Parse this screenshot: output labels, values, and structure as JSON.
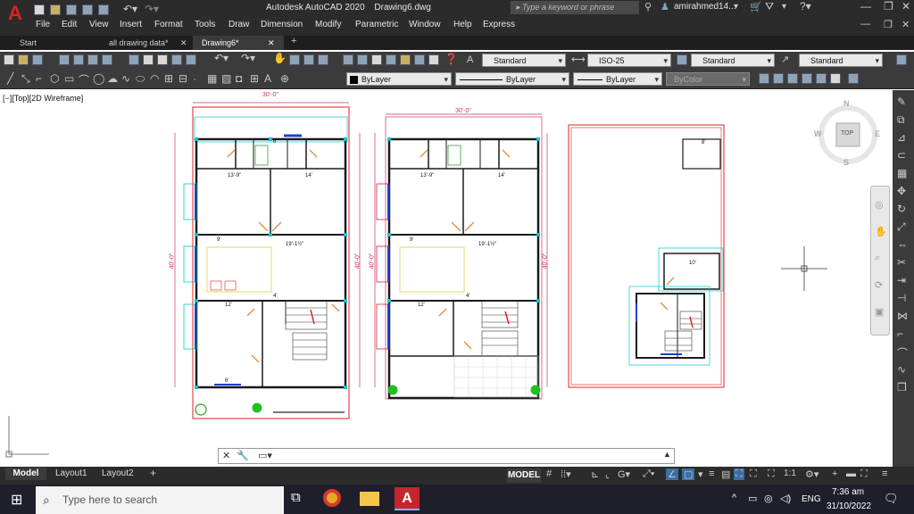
{
  "app": {
    "title": "Autodesk AutoCAD 2020",
    "filename": "Drawing6.dwg",
    "search_placeholder": "Type a keyword or phrase",
    "user": "amirahmed14...",
    "logo_letter": "A"
  },
  "menu": [
    "File",
    "Edit",
    "View",
    "Insert",
    "Format",
    "Tools",
    "Draw",
    "Dimension",
    "Modify",
    "Parametric",
    "Window",
    "Help",
    "Express"
  ],
  "tabs": [
    {
      "label": "Start"
    },
    {
      "label": "all drawing data*"
    },
    {
      "label": "Drawing6*"
    }
  ],
  "toolbar": {
    "text_style": "Standard",
    "dim_style": "ISO-25",
    "table_style": "Standard",
    "mleader_style": "Standard",
    "color": "ByLayer",
    "linetype": "ByLayer",
    "lineweight": "ByLayer",
    "plotstyle": "ByColor"
  },
  "viewport": {
    "label": "[−][Top][2D Wireframe]",
    "viewcube_top": "TOP",
    "compass_n": "N",
    "compass_s": "S",
    "compass_e": "E",
    "compass_w": "W"
  },
  "drawing": {
    "plan1": {
      "width_dim": "30'-0\"",
      "height_dim": "40'-0\"",
      "height_dim_right": "40'-0\"",
      "room_a": "13'-9\"",
      "room_b": "14'",
      "hall_dim": "19'-1½\"",
      "hall_left": "9'",
      "bed_dim": "12'",
      "stair_dim": "4'",
      "kitchen_dim": "6'",
      "small": "6'"
    },
    "plan2": {
      "width_dim": "30'-0\"",
      "height_dim": "40'-0\"",
      "height_dim_right": "40'-0\"",
      "room_a": "13'-9\"",
      "room_b": "14'",
      "hall_dim": "19'-1½\"",
      "hall_left": "9'",
      "bed_dim": "12'",
      "stair_dim": "4'"
    },
    "plan3": {
      "top_room": "8'",
      "stair_room": "10'"
    }
  },
  "command_line": {
    "value": ""
  },
  "layout_tabs": [
    "Model",
    "Layout1",
    "Layout2"
  ],
  "status": {
    "model": "MODEL",
    "scale": "1:1"
  },
  "taskbar": {
    "search": "Type here to search",
    "lang": "ENG",
    "time": "7:36 am",
    "date": "31/10/2022"
  },
  "colors": {
    "wall": "#1a1a1a",
    "dim": "#d0306a",
    "cyan": "#00c8d8",
    "door": "#e07a20",
    "window": "#2040d0",
    "accent_red": "#e02020"
  }
}
